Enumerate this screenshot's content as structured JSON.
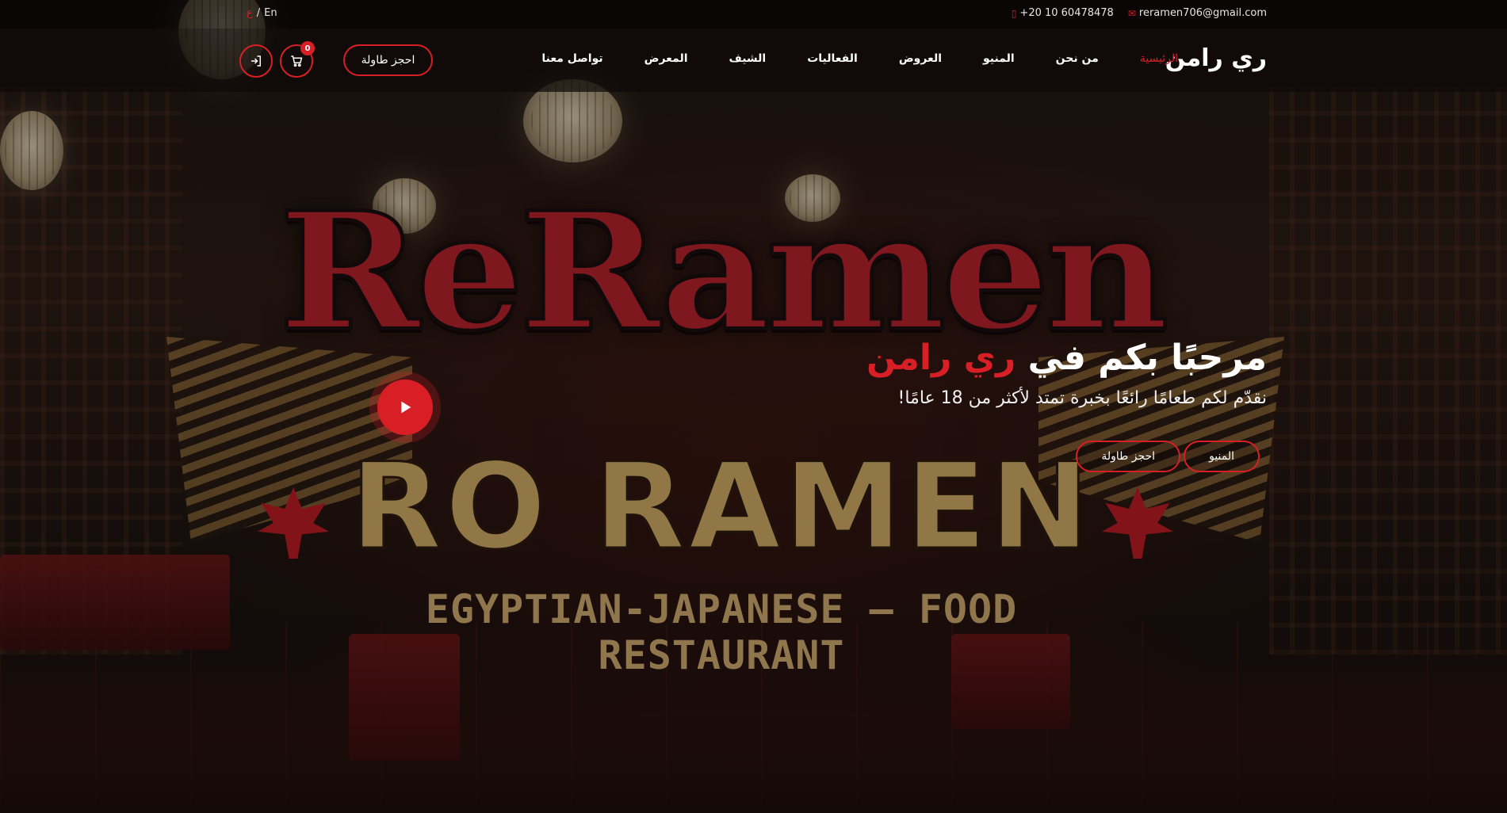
{
  "topbar": {
    "email": "reramen706@gmail.com",
    "phone": "+20 10 60478478",
    "lang_en": "En",
    "lang_sep": "/",
    "lang_ar": "ع"
  },
  "header": {
    "brand": "ري رامن",
    "nav": [
      {
        "label": "الرئيسية",
        "active": true
      },
      {
        "label": "من نحن"
      },
      {
        "label": "المنيو"
      },
      {
        "label": "العروض"
      },
      {
        "label": "الفعاليات"
      },
      {
        "label": "الشيف"
      },
      {
        "label": "المعرض"
      },
      {
        "label": "تواصل معنا"
      }
    ],
    "book_label": "احجز طاولة",
    "cart_count": "0"
  },
  "hero": {
    "title_prefix": "مرحبًا بكم في",
    "title_accent": "ري رامن",
    "subtitle": "نقدّم لكم طعامًا رائعًا بخبرة تمتد لأكثر من 18 عامًا!",
    "btn_menu": "المنيو",
    "btn_book": "احجز طاولة",
    "logo_title": "ReRamen",
    "logo_sub": "RO RAMEN",
    "logo_tag": "EGYPTIAN-JAPANESE – FOOD  RESTAURANT"
  },
  "colors": {
    "accent": "#d81f26",
    "dark": "#0e0a09"
  },
  "icons": [
    "mail-icon",
    "phone-icon",
    "cart-icon",
    "login-icon",
    "play-icon"
  ]
}
